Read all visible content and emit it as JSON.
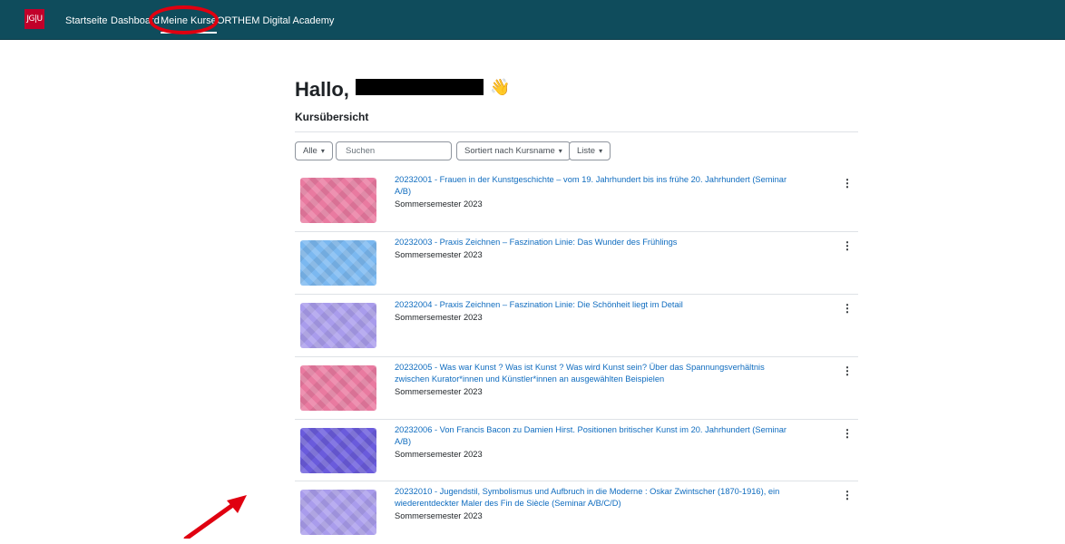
{
  "header": {
    "logo_text": "JG|U",
    "nav": [
      {
        "label": "Startseite"
      },
      {
        "label": "Dashboard"
      },
      {
        "label": "Meine Kurse"
      },
      {
        "label": "ORTHEM Digital Academy"
      }
    ],
    "active": "Meine Kurse",
    "brand_color": "#0f4c5c"
  },
  "greeting": {
    "text": "Hallo,",
    "emoji": "👋"
  },
  "section_title": "Kursübersicht",
  "filters": {
    "grouping": "Alle",
    "search_placeholder": "Suchen",
    "sort": "Sortiert nach Kursname",
    "view": "Liste"
  },
  "courses": [
    {
      "title": "20232001 - Frauen in der Kunstgeschichte – vom 19. Jahrhundert bis ins frühe 20. Jahrhundert (Seminar A/B)",
      "semester": "Sommersemester 2023",
      "color": "#e97aa0"
    },
    {
      "title": "20232003 - Praxis Zeichnen – Faszination Linie: Das Wunder des Frühlings",
      "semester": "Sommersemester 2023",
      "color": "#7bb8f0"
    },
    {
      "title": "20232004 - Praxis Zeichnen – Faszination Linie: Die Schönheit liegt im Detail",
      "semester": "Sommersemester 2023",
      "color": "#a99cec"
    },
    {
      "title": "20232005 - Was war Kunst ? Was ist Kunst ? Was wird Kunst sein? Über das Spannungsverhältnis zwischen Kurator*innen und Künstler*innen an ausgewählten Beispielen",
      "semester": "Sommersemester 2023",
      "color": "#e97aa0"
    },
    {
      "title": "20232006 - Von Francis Bacon zu Damien Hirst. Positionen britischer Kunst im 20. Jahrhundert (Seminar A/B)",
      "semester": "Sommersemester 2023",
      "color": "#6a5bdc"
    },
    {
      "title": "20232010 - Jugendstil, Symbolismus und Aufbruch in die Moderne : Oskar Zwintscher (1870-1916), ein wiederentdeckter Maler des Fin de Siècle (Seminar A/B/C/D)",
      "semester": "Sommersemester 2023",
      "color": "#a99cec"
    }
  ]
}
